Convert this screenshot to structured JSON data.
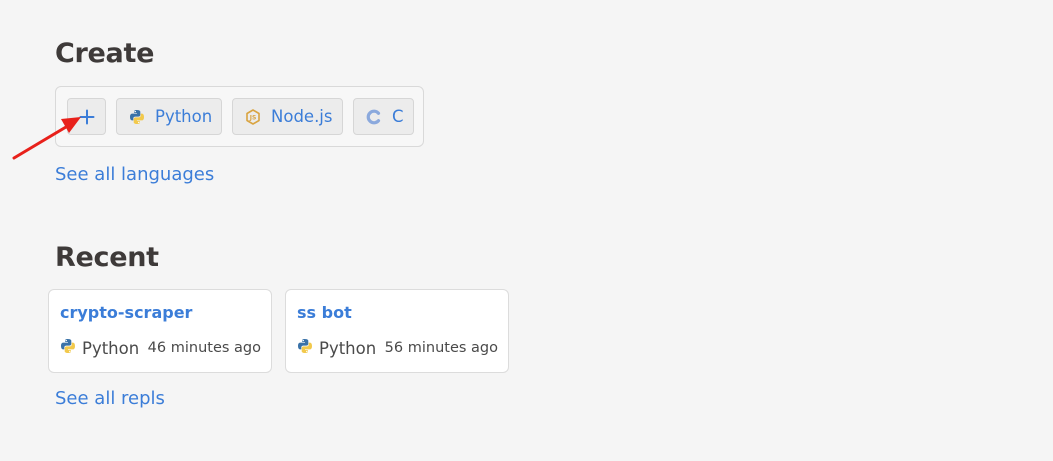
{
  "create": {
    "title": "Create",
    "chips": [
      {
        "icon": "plus-icon"
      },
      {
        "label": "Python",
        "icon": "python-icon"
      },
      {
        "label": "Node.js",
        "icon": "nodejs-icon"
      },
      {
        "label": "C",
        "icon": "c-language-icon"
      }
    ],
    "see_all_label": "See all languages"
  },
  "recent": {
    "title": "Recent",
    "repls": [
      {
        "name": "crypto-scraper",
        "language": "Python",
        "time": "46 minutes ago",
        "icon": "python-icon"
      },
      {
        "name": "ss bot",
        "language": "Python",
        "time": "56 minutes ago",
        "icon": "python-icon"
      }
    ],
    "see_all_label": "See all repls"
  },
  "annotation": {
    "type": "arrow",
    "color": "#e8201a",
    "points_to": "plus-icon"
  },
  "colors": {
    "background": "#f5f5f5",
    "link": "#3b7dd8",
    "chip_bg": "#ececec",
    "python_blue": "#3a72a8",
    "python_yellow": "#f2c94c",
    "node_gold": "#d9a441",
    "c_blue": "#8ba9dd"
  }
}
